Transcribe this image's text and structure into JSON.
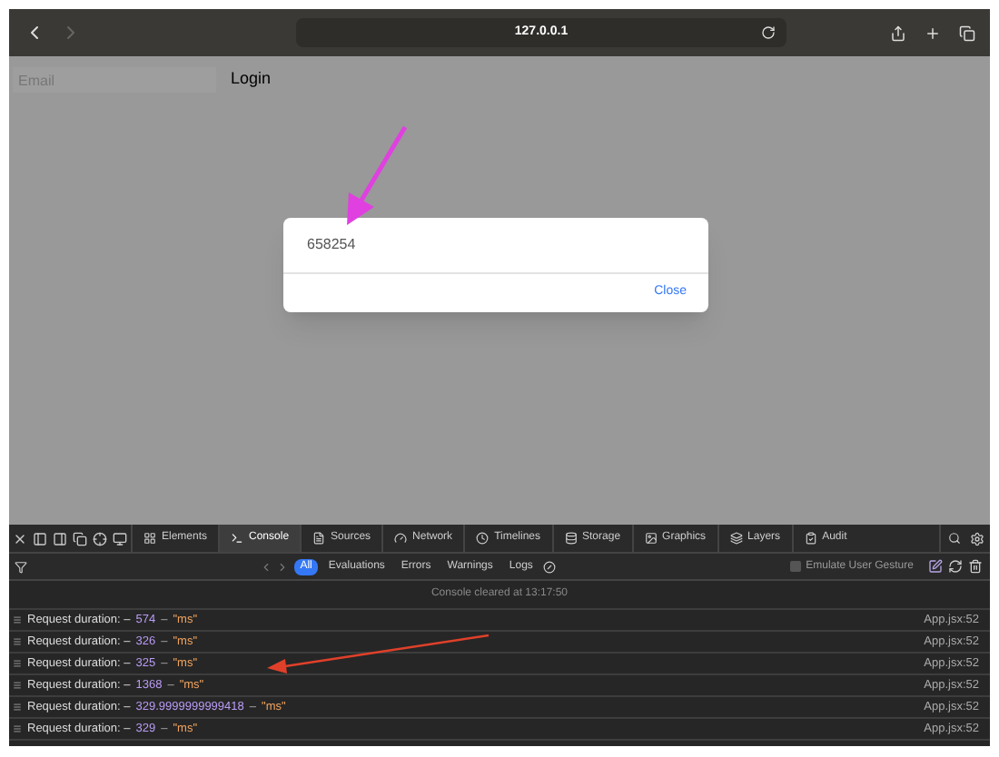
{
  "browser": {
    "url": "127.0.0.1"
  },
  "page": {
    "email_placeholder": "Email",
    "login_label": "Login"
  },
  "dialog": {
    "message": "658254",
    "close_label": "Close"
  },
  "devtools": {
    "tabs": [
      {
        "label": "Elements",
        "selected": false
      },
      {
        "label": "Console",
        "selected": true
      },
      {
        "label": "Sources",
        "selected": false
      },
      {
        "label": "Network",
        "selected": false
      },
      {
        "label": "Timelines",
        "selected": false
      },
      {
        "label": "Storage",
        "selected": false
      },
      {
        "label": "Graphics",
        "selected": false
      },
      {
        "label": "Layers",
        "selected": false
      },
      {
        "label": "Audit",
        "selected": false
      }
    ],
    "filters": [
      {
        "label": "All",
        "selected": true
      },
      {
        "label": "Evaluations",
        "selected": false
      },
      {
        "label": "Errors",
        "selected": false
      },
      {
        "label": "Warnings",
        "selected": false
      },
      {
        "label": "Logs",
        "selected": false
      }
    ],
    "emulate_gesture": {
      "label": "Emulate User Gesture",
      "checked": false
    },
    "cleared_notice": "Console cleared at 13:17:50",
    "logs": [
      {
        "text": "Request duration: –",
        "value": "574",
        "sep": "–",
        "unit": "\"ms\"",
        "source": "App.jsx:52"
      },
      {
        "text": "Request duration: –",
        "value": "326",
        "sep": "–",
        "unit": "\"ms\"",
        "source": "App.jsx:52"
      },
      {
        "text": "Request duration: –",
        "value": "325",
        "sep": "–",
        "unit": "\"ms\"",
        "source": "App.jsx:52"
      },
      {
        "text": "Request duration: –",
        "value": "1368",
        "sep": "–",
        "unit": "\"ms\"",
        "source": "App.jsx:52"
      },
      {
        "text": "Request duration: –",
        "value": "329.9999999999418",
        "sep": "–",
        "unit": "\"ms\"",
        "source": "App.jsx:52"
      },
      {
        "text": "Request duration: –",
        "value": "329",
        "sep": "–",
        "unit": "\"ms\"",
        "source": "App.jsx:52"
      }
    ]
  }
}
